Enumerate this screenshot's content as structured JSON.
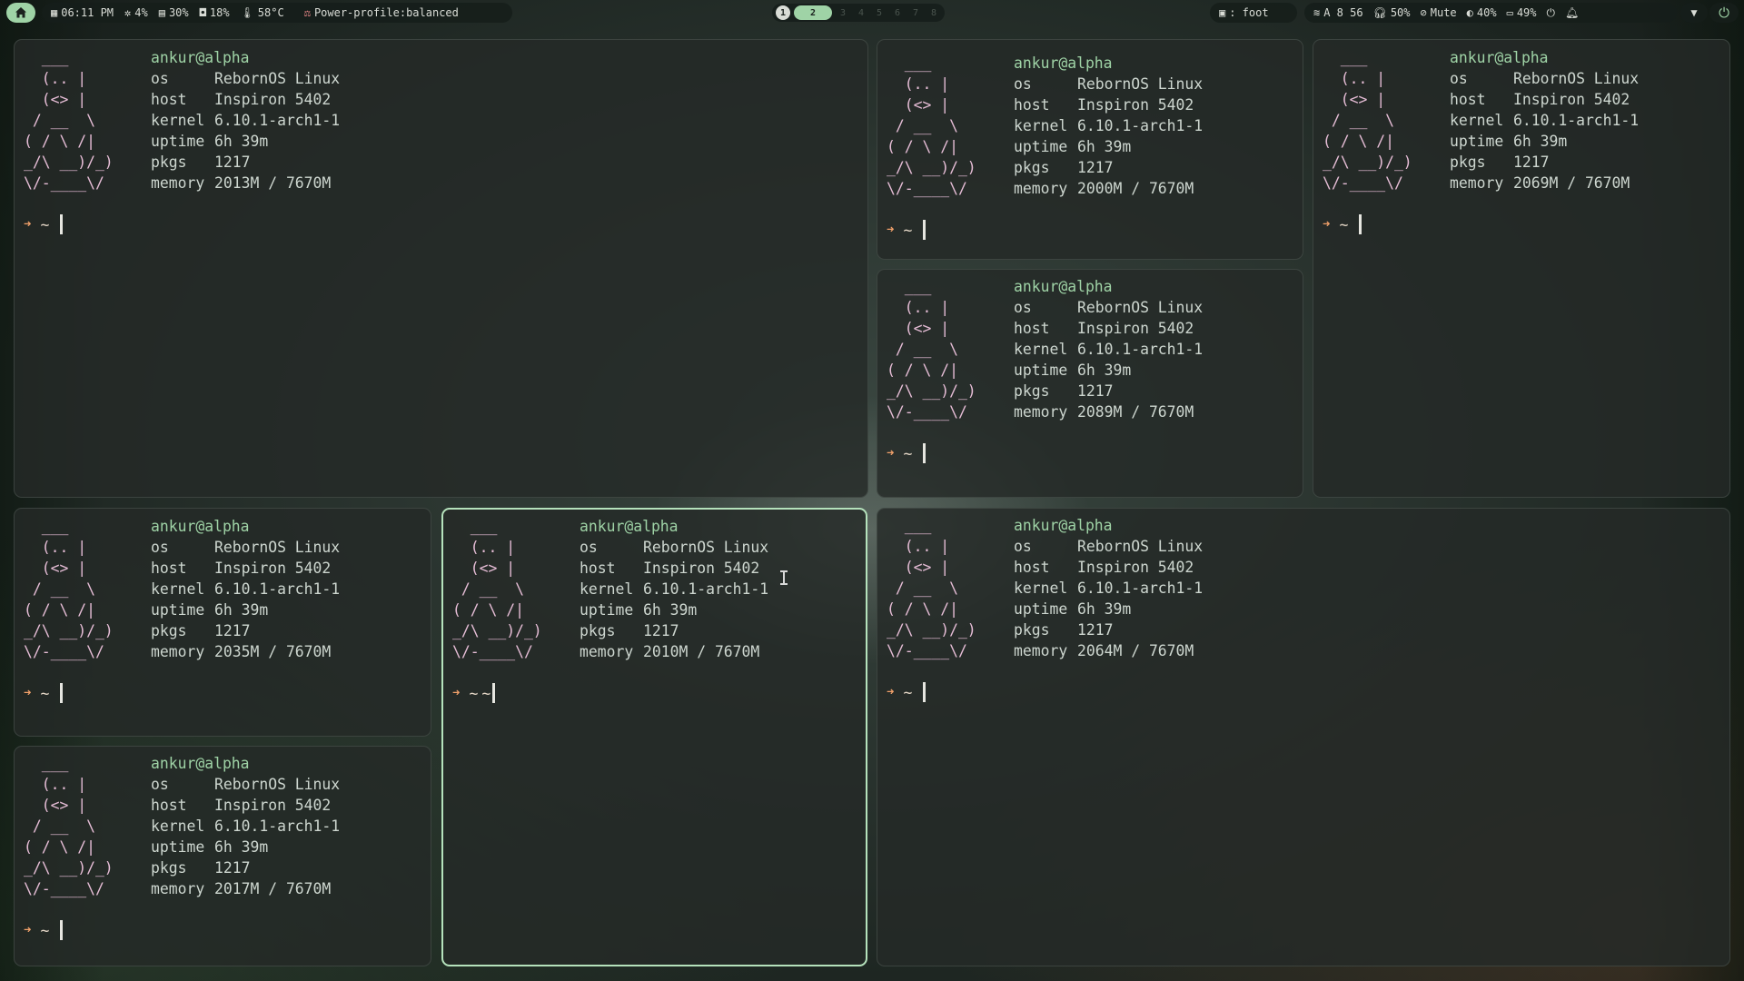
{
  "bar": {
    "time": "06:11 PM",
    "cpu": "4%",
    "mem": "30%",
    "disk": "18%",
    "temp": "58°C",
    "power_profile": "Power-profile:balanced",
    "window_title": ": foot",
    "wifi": "A 8 56",
    "headphones": "50%",
    "mic": "Mute",
    "brightness": "40%",
    "battery": "49%",
    "workspaces": [
      "1",
      "2",
      "3",
      "4",
      "5",
      "6",
      "7",
      "8"
    ],
    "active_workspace": "2",
    "accent": "#9fd3a6"
  },
  "fetch": {
    "logo": [
      "  ___",
      "  (.. |",
      "  (<> |",
      " / __  \\",
      "( / \\ /|",
      "_/\\ __)/_)",
      "\\/-____\\/"
    ],
    "user": "ankur@alpha",
    "labels": {
      "os": "os",
      "host": "host",
      "kernel": "kernel",
      "uptime": "uptime",
      "pkgs": "pkgs",
      "memory": "memory"
    },
    "os": "RebornOS Linux",
    "host": "Inspiron 5402",
    "kernel": "6.10.1-arch1-1",
    "uptime": "6h 39m",
    "pkgs": "1217"
  },
  "prompt": {
    "arrow": "➜",
    "dir": "~"
  },
  "terminals": [
    {
      "memory": "2013M / 7670M"
    },
    {
      "memory": "2000M / 7670M"
    },
    {
      "memory": "2069M / 7670M"
    },
    {
      "memory": "2089M / 7670M"
    },
    {
      "memory": "2035M / 7670M"
    },
    {
      "memory": "2010M / 7670M",
      "extra": "~"
    },
    {
      "memory": "2064M / 7670M"
    },
    {
      "memory": "2017M / 7670M"
    }
  ]
}
